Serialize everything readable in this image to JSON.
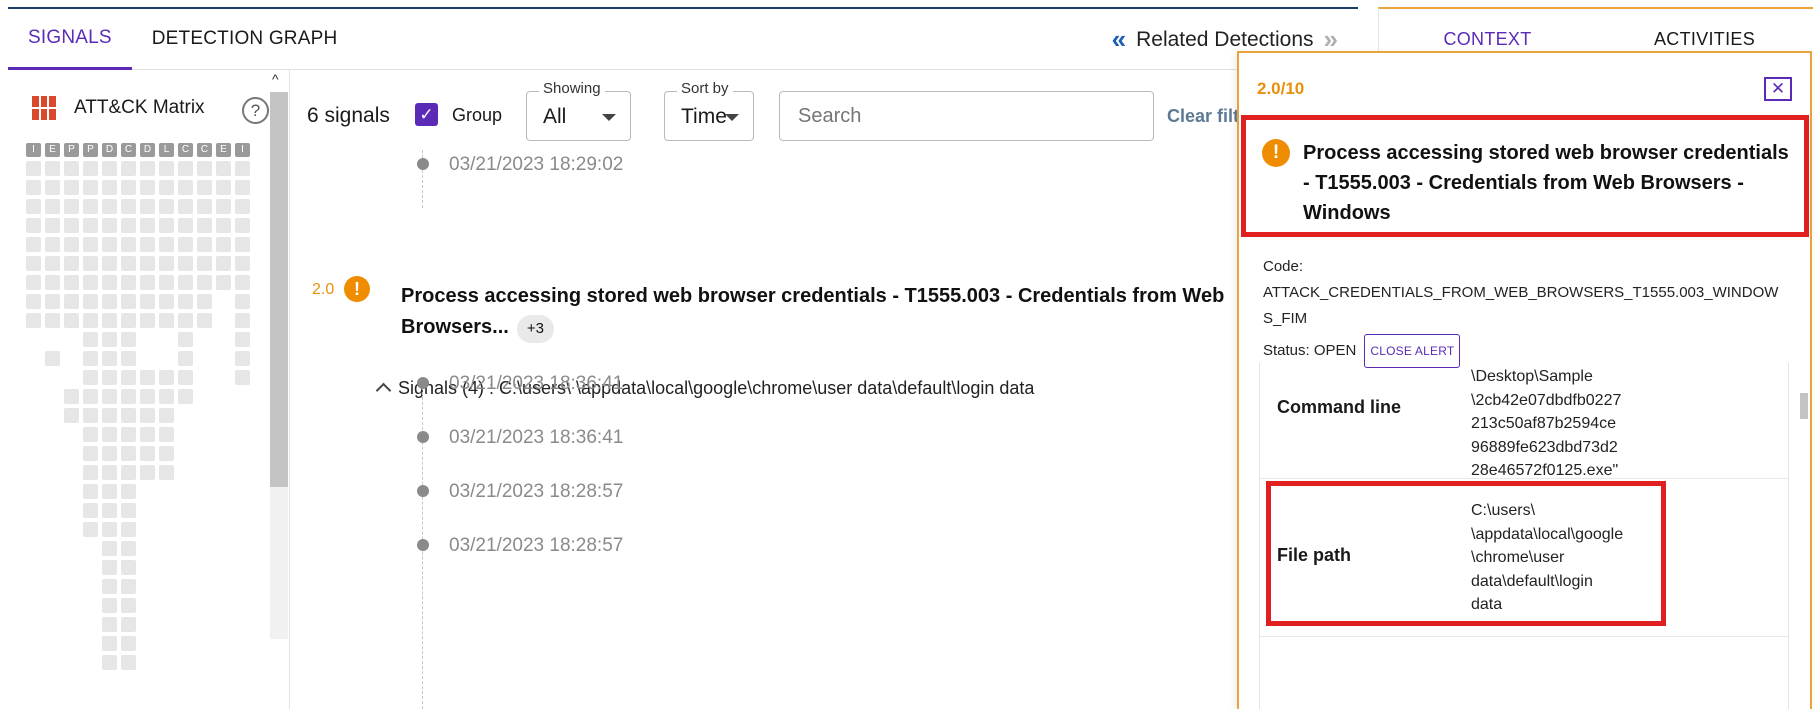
{
  "header": {
    "tabs": [
      {
        "label": "SIGNALS",
        "active": true
      },
      {
        "label": "DETECTION GRAPH",
        "active": false
      }
    ],
    "related_label": "Related Detections",
    "prev_icon": "double-chevron-left-icon",
    "next_icon": "double-chevron-right-icon"
  },
  "matrix": {
    "title": "ATT&CK Matrix",
    "help_icon": "question-circle-icon",
    "column_heads": [
      "I",
      "E",
      "P",
      "P",
      "D",
      "C",
      "D",
      "L",
      "C",
      "C",
      "E",
      "I"
    ]
  },
  "toolbar": {
    "signals_count": "6 signals",
    "group_checked": true,
    "group_label": "Group",
    "showing_label": "Showing",
    "showing_value": "All",
    "sort_label": "Sort by",
    "sort_value": "Time",
    "search_placeholder": "Search",
    "clear_filters": "Clear filt"
  },
  "timeline": {
    "first_time": "03/21/2023 18:29:02",
    "detection": {
      "score": "2.0",
      "title": "Process accessing stored web browser credentials - T1555.003 - Credentials from Web Browsers...",
      "more_badge": "+3",
      "signals_label": "Signals (4) : C:\\users\\              \\appdata\\local\\google\\chrome\\user data\\default\\login data"
    },
    "signal_times": [
      "03/21/2023 18:36:41",
      "03/21/2023 18:36:41",
      "03/21/2023 18:28:57",
      "03/21/2023 18:28:57"
    ]
  },
  "context_panel": {
    "tabs": [
      {
        "label": "CONTEXT",
        "active": true
      },
      {
        "label": "ACTIVITIES",
        "active": false
      }
    ]
  },
  "popup": {
    "score": "2.0/10",
    "close_icon": "close-x-icon",
    "title": "Process accessing stored web browser credentials - T1555.003 - Credentials from Web Browsers - Windows",
    "code_label": "Code:",
    "code_value": "ATTACK_CREDENTIALS_FROM_WEB_BROWSERS_T1555.003_WINDOWS_FIM",
    "status_label": "Status: OPEN",
    "close_alert_label": "CLOSE ALERT",
    "rows": [
      {
        "key": "Command line",
        "value_lines": [
          "\\Desktop\\Sample",
          "\\2cb42e07dbdfb0227",
          "213c50af87b2594ce",
          "96889fe623dbd73d2",
          "28e46572f0125.exe\""
        ]
      },
      {
        "key": "File path",
        "value_lines": [
          "C:\\users\\",
          "\\appdata\\local\\google",
          "\\chrome\\user",
          "data\\default\\login",
          "data"
        ]
      }
    ]
  },
  "colors": {
    "accent_purple": "#5b2bb8",
    "score_orange": "#e8900a",
    "highlight_red": "#e02020",
    "matrix_red": "#d9492b"
  }
}
